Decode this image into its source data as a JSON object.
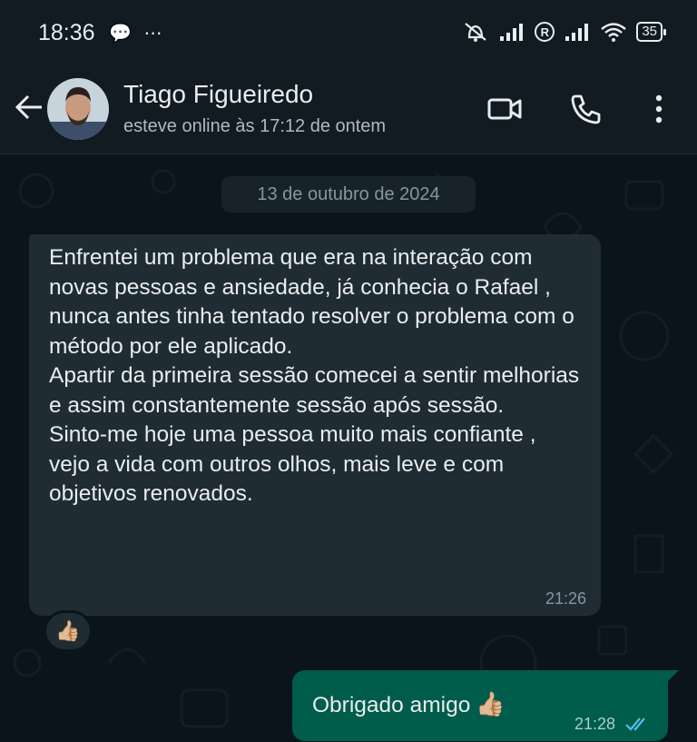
{
  "status_bar": {
    "time": "18:36",
    "left_icons": "💬 ⋯",
    "battery": "35",
    "signal_r": "R"
  },
  "header": {
    "contact_name": "Tiago Figueiredo",
    "contact_status": "esteve online às 17:12 de ontem",
    "icons": [
      "back-arrow-icon",
      "video-call-icon",
      "voice-call-icon",
      "more-options-icon"
    ]
  },
  "chat": {
    "date_chip": "13 de outubro de 2024",
    "incoming": {
      "paragraphs": [
        "Enfrentei um problema que era na interação com novas pessoas e ansiedade, já conhecia o Rafael , nunca antes tinha tentado resolver o problema com o método por ele aplicado.",
        "Apartir da primeira sessão comecei a sentir melhorias e assim constantemente sessão após sessão.",
        "Sinto-me hoje uma pessoa muito mais confiante , vejo a vida com outros olhos, mais leve e com objetivos renovados."
      ],
      "time": "21:26",
      "reaction": "👍🏼"
    },
    "outgoing": {
      "text": "Obrigado amigo",
      "emoji": "👍🏼",
      "time": "21:28",
      "status": "read"
    }
  },
  "colors": {
    "background": "#0b141a",
    "header": "#111b21",
    "incoming_bubble": "#202c33",
    "outgoing_bubble": "#005c4b",
    "read_ticks": "#53bdeb"
  }
}
